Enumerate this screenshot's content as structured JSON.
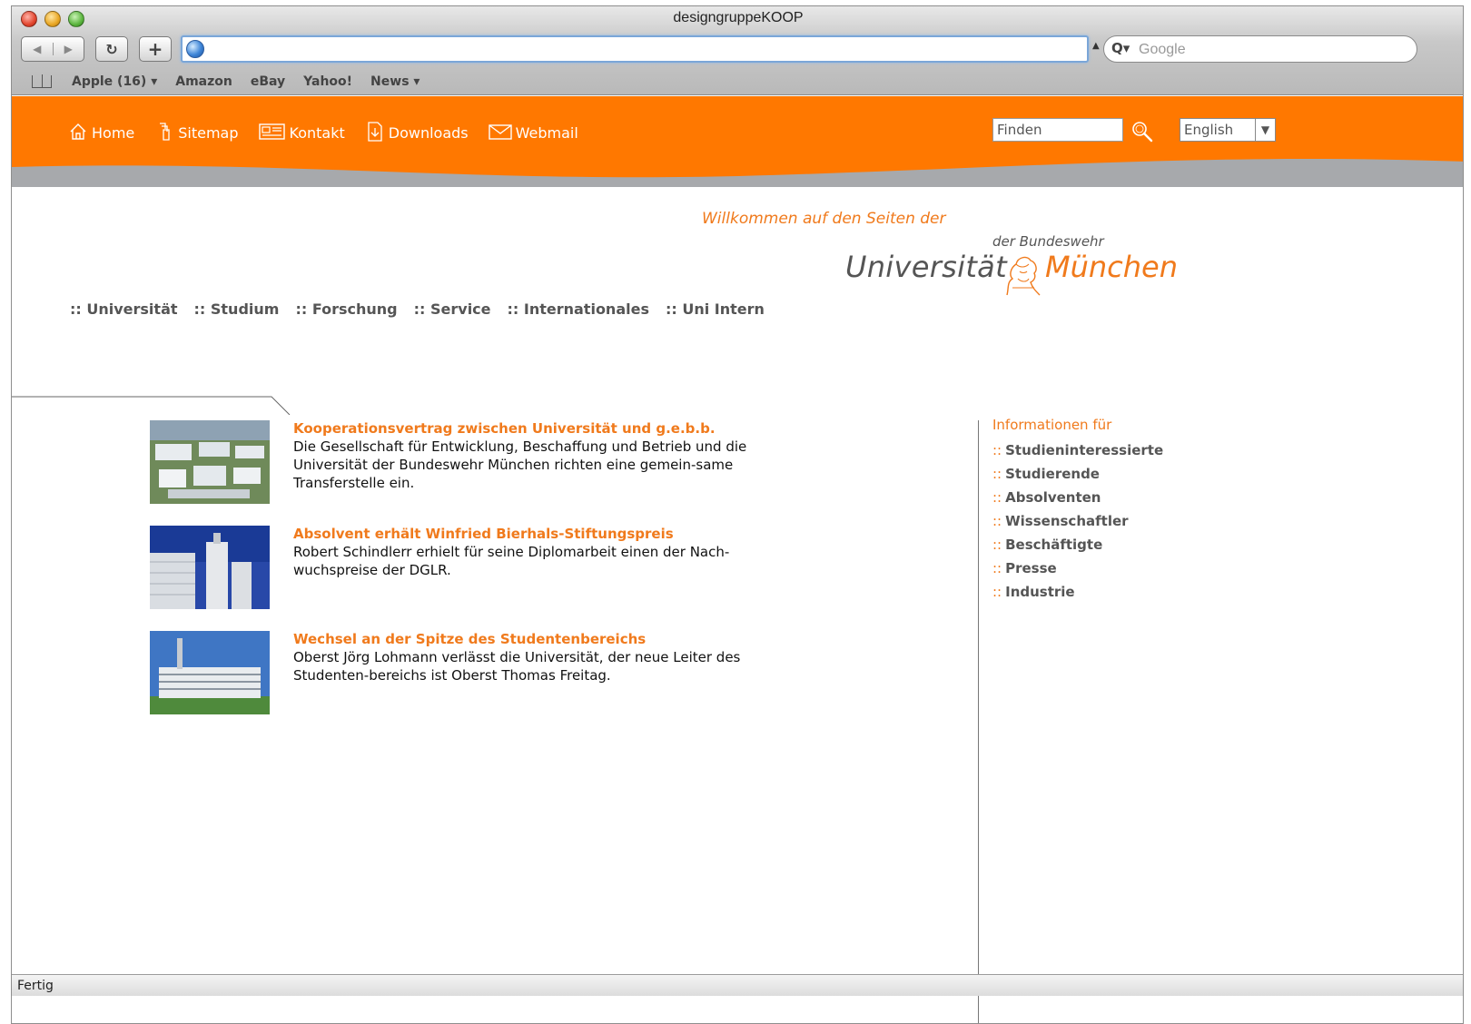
{
  "window": {
    "title": "designgruppeKOOP"
  },
  "toolbar": {
    "back_icon": "back-arrow-icon",
    "forward_icon": "forward-arrow-icon",
    "reload_glyph": "↻",
    "add_glyph": "+",
    "url_value": "",
    "search_placeholder": "Google"
  },
  "bookmarks": [
    "Apple (16) ▾",
    "Amazon",
    "eBay",
    "Yahoo!",
    "News ▾"
  ],
  "topnav": [
    {
      "label": "Home",
      "icon": "home-icon"
    },
    {
      "label": "Sitemap",
      "icon": "sitemap-icon"
    },
    {
      "label": "Kontakt",
      "icon": "contact-card-icon"
    },
    {
      "label": "Downloads",
      "icon": "download-icon"
    },
    {
      "label": "Webmail",
      "icon": "envelope-icon"
    }
  ],
  "search": {
    "value": "Finden"
  },
  "language": {
    "selected": "English"
  },
  "logo": {
    "welcome": "Willkommen auf den Seiten der",
    "der_bundeswehr": "der Bundeswehr",
    "universitaet": "Universität",
    "muenchen": "München"
  },
  "mainnav": [
    ":: Universität",
    ":: Studium",
    ":: Forschung",
    ":: Service",
    ":: Internationales",
    ":: Uni Intern"
  ],
  "news": [
    {
      "title": "Kooperationsvertrag zwischen Universität und g.e.b.b.",
      "text": "Die Gesellschaft für Entwicklung, Beschaffung und Betrieb und die Universität der Bundeswehr München richten eine gemein-same Transferstelle ein."
    },
    {
      "title": "Absolvent erhält Winfried Bierhals-Stiftungspreis",
      "text": "Robert Schindlerr erhielt für seine Diplomarbeit einen der Nach-wuchspreise der DGLR."
    },
    {
      "title": "Wechsel an der Spitze des Studentenbereichs",
      "text": "Oberst Jörg Lohmann verlässt die Universität, der neue Leiter des Studenten-bereichs ist Oberst Thomas Freitag."
    }
  ],
  "sidebar": {
    "heading": "Informationen für",
    "prefix": "::",
    "items": [
      "Studieninteressierte",
      "Studierende",
      "Absolventen",
      "Wissenschaftler",
      "Beschäftigte",
      "Presse",
      "Industrie"
    ]
  },
  "status": {
    "text": "Fertig"
  },
  "colors": {
    "accent": "#ff7800",
    "accent_text": "#f07a1c",
    "header_band": "#a7a9ac",
    "nav_text": "#555555"
  }
}
